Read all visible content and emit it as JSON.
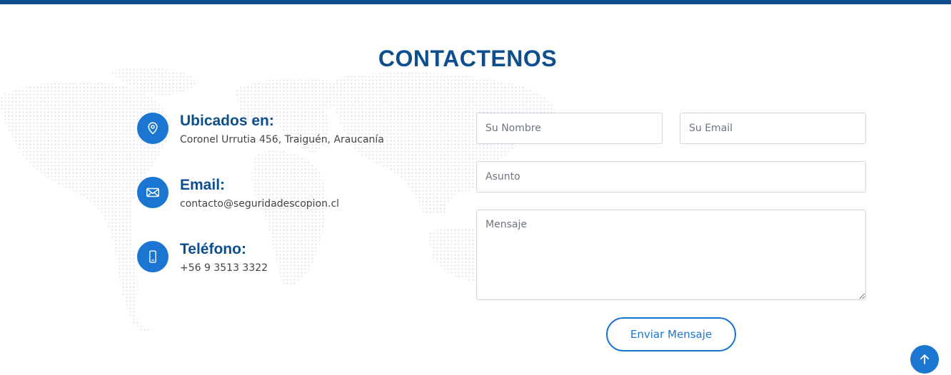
{
  "section": {
    "title": "CONTACTENOS"
  },
  "contact_info": [
    {
      "icon": "location-pin-icon",
      "label": "Ubicados en:",
      "value": "Coronel Urrutia 456, Traiguén, Araucanía"
    },
    {
      "icon": "envelope-icon",
      "label": "Email:",
      "value": "contacto@seguridadescopion.cl"
    },
    {
      "icon": "mobile-phone-icon",
      "label": "Teléfono:",
      "value": "+56 9 3513 3322"
    }
  ],
  "form": {
    "name_placeholder": "Su Nombre",
    "email_placeholder": "Su Email",
    "subject_placeholder": "Asunto",
    "message_placeholder": "Mensaje",
    "submit_label": "Enviar Mensaje"
  },
  "colors": {
    "primary": "#1a76d1",
    "heading": "#0d4e8c",
    "map_dots": "#e9ecf0"
  },
  "back_to_top": {
    "icon": "arrow-up-icon"
  }
}
